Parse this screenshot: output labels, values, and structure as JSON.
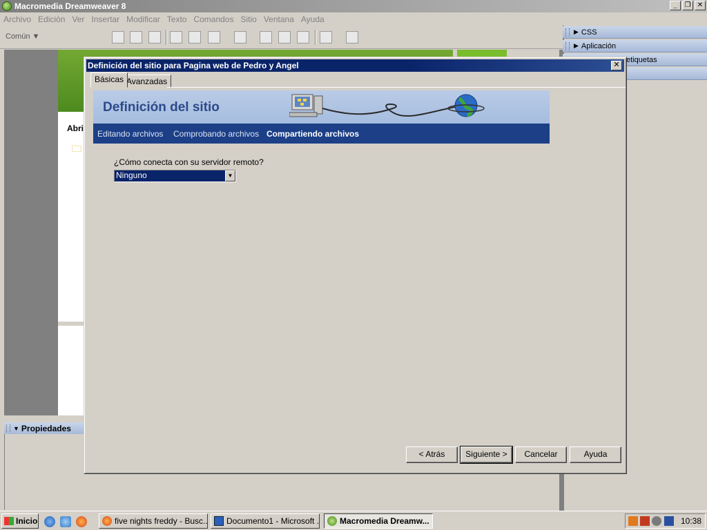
{
  "app": {
    "title": "Macromedia Dreamweaver 8",
    "minimize": "_",
    "restore": "❐",
    "close": "✕"
  },
  "menu": [
    "Archivo",
    "Edición",
    "Ver",
    "Insertar",
    "Modificar",
    "Texto",
    "Comandos",
    "Sitio",
    "Ventana",
    "Ayuda"
  ],
  "toolbar": {
    "category": "Común ▼"
  },
  "panels": {
    "css": "CSS",
    "aplicacion": "Aplicación",
    "etiquetas": "etiquetas"
  },
  "document": {
    "partial_heading": "Abri"
  },
  "properties": {
    "label": "Propiedades"
  },
  "dialog": {
    "title": "Definición del sitio para Pagina web de Pedro y Angel",
    "close": "✕",
    "tabs": [
      "Básicas",
      "Avanzadas"
    ],
    "banner_title": "Definición del sitio",
    "steps": [
      "Editando archivos",
      "Comprobando archivos",
      "Compartiendo archivos"
    ],
    "question": "¿Cómo conecta con su servidor remoto?",
    "connection_value": "Ninguno",
    "buttons": {
      "back": "< Atrás",
      "next": "Siguiente >",
      "cancel": "Cancelar",
      "help": "Ayuda"
    }
  },
  "taskbar": {
    "start": "Inicio",
    "tasks": [
      "five nights freddy - Busc...",
      "Documento1 - Microsoft ...",
      "Macromedia Dreamw..."
    ],
    "clock": "10:38"
  },
  "colors": {
    "dialog_title": "#0a246a",
    "banner_nav": "#1c3f87",
    "banner": "#b9cbe6",
    "accent_green": "#4d8a1f"
  }
}
